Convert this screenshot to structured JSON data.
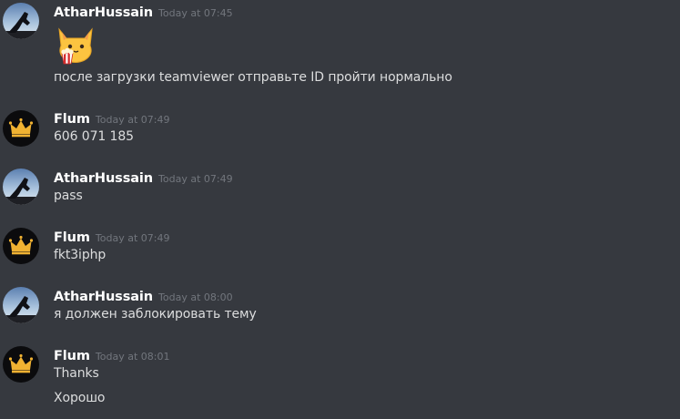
{
  "messages": [
    {
      "author": "AtharHussain",
      "timestamp": "Today at 07:45",
      "avatar_icon": "athar-avatar",
      "emoji_icon": "cat-popcorn-emoji",
      "lines": [
        "после загрузки teamviewer отправьте ID пройти нормально"
      ]
    },
    {
      "author": "Flum",
      "timestamp": "Today at 07:49",
      "avatar_icon": "crown-avatar",
      "lines": [
        "606 071 185"
      ]
    },
    {
      "author": "AtharHussain",
      "timestamp": "Today at 07:49",
      "avatar_icon": "athar-avatar",
      "lines": [
        "pass"
      ]
    },
    {
      "author": "Flum",
      "timestamp": "Today at 07:49",
      "avatar_icon": "crown-avatar",
      "lines": [
        "fkt3iphp"
      ]
    },
    {
      "author": "AtharHussain",
      "timestamp": "Today at 08:00",
      "avatar_icon": "athar-avatar",
      "lines": [
        "я должен заблокировать тему"
      ]
    },
    {
      "author": "Flum",
      "timestamp": "Today at 08:01",
      "avatar_icon": "crown-avatar",
      "lines": [
        "Thanks",
        "Хорошо"
      ]
    }
  ],
  "colors": {
    "background": "#36393f",
    "username": "#ffffff",
    "timestamp": "#72767d",
    "message_text": "#dcddde",
    "crown_gold": "#f0b232"
  }
}
